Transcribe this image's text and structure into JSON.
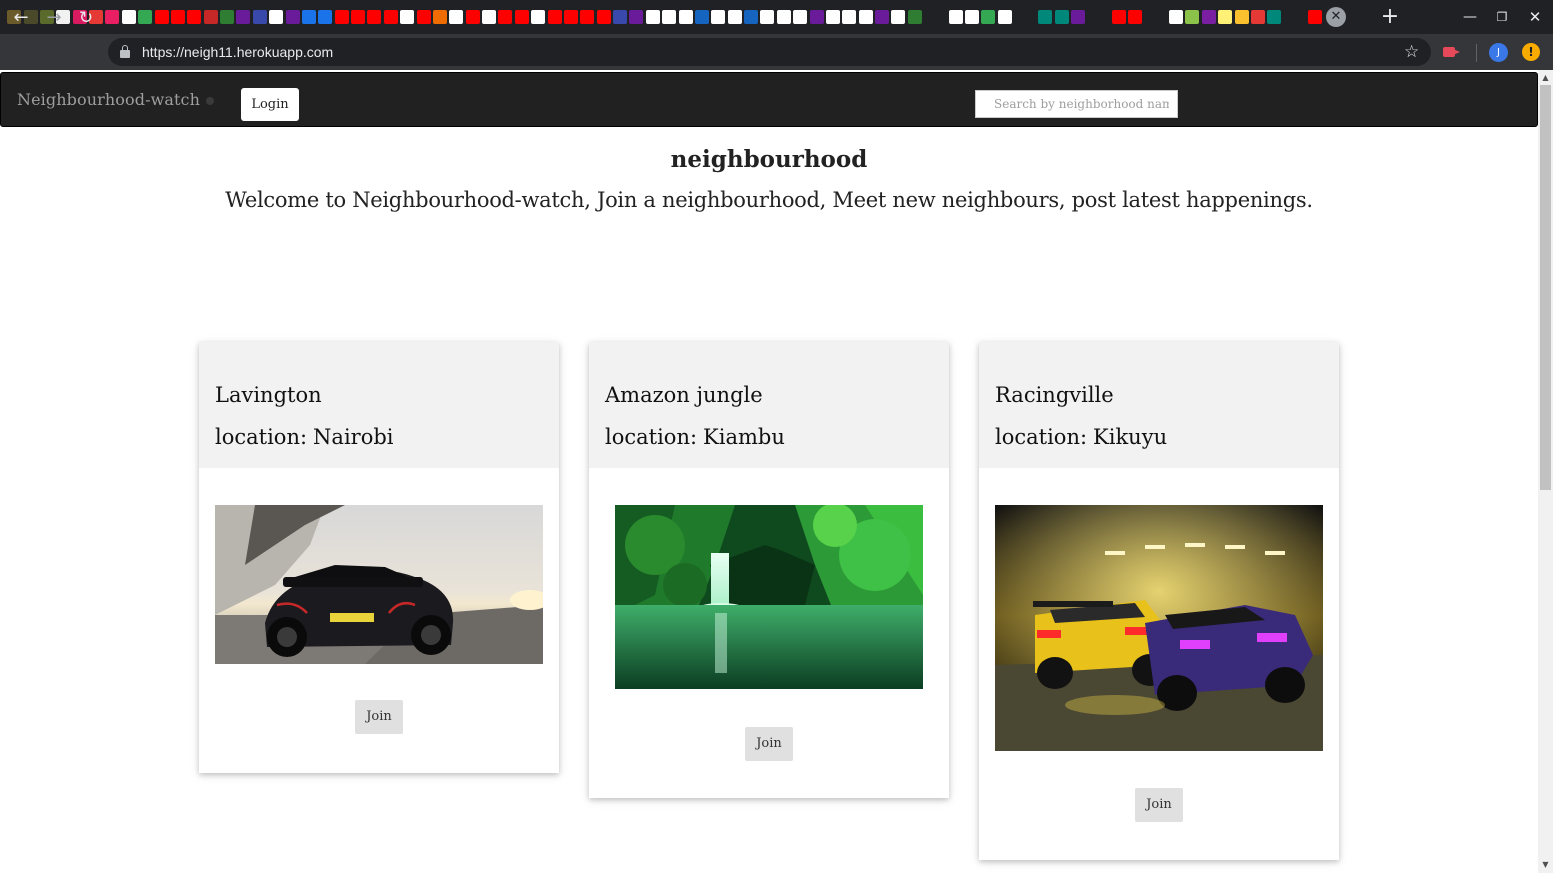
{
  "browser": {
    "url": "https://neigh11.herokuapp.com",
    "profile_initial": "J",
    "tab_favicon_colors": [
      "#6b5a2a",
      "#4a4a2a",
      "#5a6a2a",
      "#f1f1f1",
      "#d81b60",
      "#e53935",
      "#e91e63",
      "#ffffff",
      "#34a853",
      "#ff0000",
      "#ff0000",
      "#ff0000",
      "#c62828",
      "#2e7d32",
      "#6a1b9a",
      "#3949ab",
      "#ffffff",
      "#6a1b9a",
      "#1a73e8",
      "#1a73e8",
      "#ff0000",
      "#ff0000",
      "#ff0000",
      "#ff0000",
      "#ffffff",
      "#ff0000",
      "#ef6c00",
      "#ffffff",
      "#ff0000",
      "#ffffff",
      "#ff0000",
      "#ff0000",
      "#ffffff",
      "#ff0000",
      "#ff0000",
      "#ff0000",
      "#ff0000",
      "#3949ab",
      "#6a1b9a",
      "#ffffff",
      "#ffffff",
      "#ffffff",
      "#1565c0",
      "#ffffff",
      "#ffffff",
      "#1565c0",
      "#ffffff",
      "#ffffff",
      "#ffffff",
      "#6a1b9a",
      "#ffffff",
      "#ffffff",
      "#ffffff",
      "#6a1b9a",
      "#ffffff",
      "#2e7d32",
      "#gap",
      "#ffffff",
      "#ffffff",
      "#34a853",
      "#ffffff",
      "#gap",
      "#00897b",
      "#00897b",
      "#6a1b9a",
      "#gap",
      "#ff0000",
      "#ff0000",
      "#gap",
      "#ffffff",
      "#8bc34a",
      "#7b1fa2",
      "#fff176",
      "#fbc02d",
      "#e53935",
      "#00897b",
      "#gap",
      "#ff0000",
      "#ff0000",
      "#ffffff"
    ]
  },
  "navbar": {
    "brand": "Neighbourhood-watch",
    "login_label": "Login",
    "search_placeholder": "Search by neighborhood name",
    "search_value": ""
  },
  "hero": {
    "title": "neighbourhood",
    "subtitle": "Welcome to Neighbourhood-watch, Join a neighbourhood, Meet new neighbours, post latest happenings."
  },
  "cards": [
    {
      "name": "Lavington",
      "location_prefix": "location:",
      "location": "Nairobi",
      "image": "black-supercar-photo",
      "join_label": "Join"
    },
    {
      "name": "Amazon jungle",
      "location_prefix": "location:",
      "location": "Kiambu",
      "image": "jungle-waterfall-photo",
      "join_label": "Join"
    },
    {
      "name": "Racingville",
      "location_prefix": "location:",
      "location": "Kikuyu",
      "image": "street-racing-cars-photo",
      "join_label": "Join"
    }
  ],
  "colors": {
    "navbar_bg": "#212121",
    "card_header_bg": "#f2f2f2",
    "join_button_bg": "#e0e0e0",
    "brand_text": "#9e9e9e"
  }
}
